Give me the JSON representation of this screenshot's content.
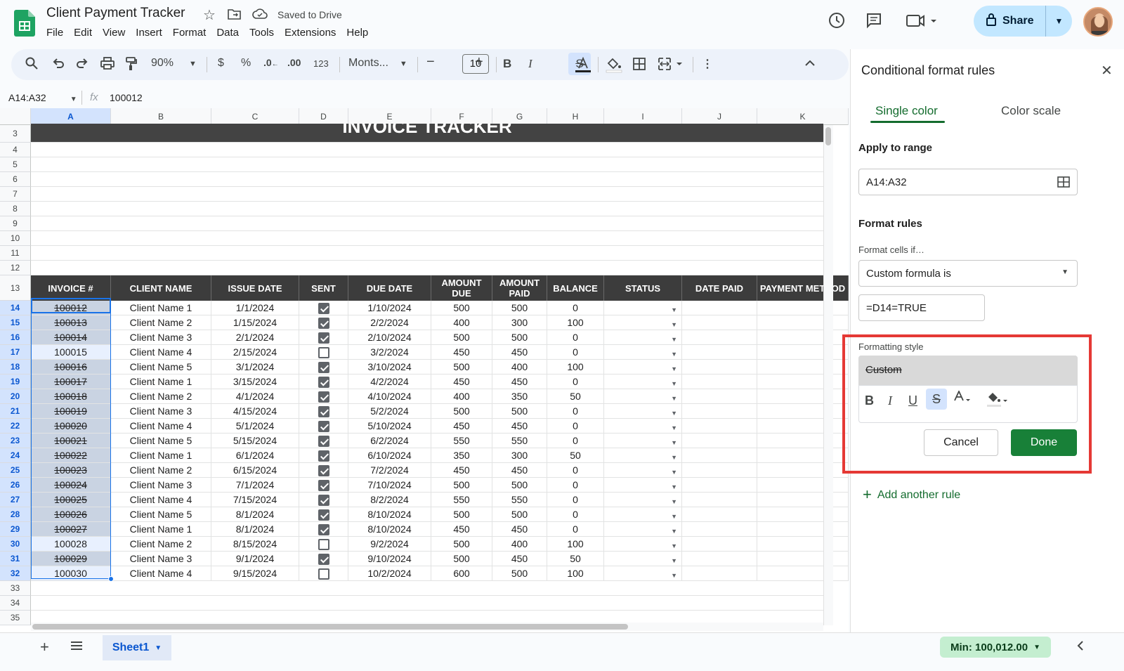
{
  "header": {
    "doc_title": "Client Payment Tracker",
    "saved_status": "Saved to Drive",
    "menus": [
      "File",
      "Edit",
      "View",
      "Insert",
      "Format",
      "Data",
      "Tools",
      "Extensions",
      "Help"
    ],
    "share_label": "Share"
  },
  "toolbar": {
    "zoom": "90%",
    "currency": "$",
    "percent": "%",
    "dec_less": ".0",
    "dec_more": ".00",
    "number_format": "123",
    "font": "Monts...",
    "font_size": "10"
  },
  "formula_bar": {
    "name_box": "A14:A32",
    "fx": "fx",
    "value": "100012"
  },
  "grid": {
    "columns": [
      "A",
      "B",
      "C",
      "D",
      "E",
      "F",
      "G",
      "H",
      "I",
      "J",
      "K"
    ],
    "row_numbers": [
      "3",
      "4",
      "5",
      "6",
      "7",
      "8",
      "9",
      "10",
      "11",
      "12",
      "13",
      "14",
      "15",
      "16",
      "17",
      "18",
      "19",
      "20",
      "21",
      "22",
      "23",
      "24",
      "25",
      "26",
      "27",
      "28",
      "29",
      "30",
      "31",
      "32",
      "33",
      "34",
      "35"
    ],
    "title_banner": "INVOICE TRACKER",
    "headers": [
      "INVOICE #",
      "CLIENT NAME",
      "ISSUE DATE",
      "SENT",
      "DUE DATE",
      "AMOUNT DUE",
      "AMOUNT PAID",
      "BALANCE",
      "STATUS",
      "DATE PAID",
      "PAYMENT METHOD"
    ],
    "rows": [
      [
        "100012",
        "Client Name 1",
        "1/1/2024",
        true,
        "1/10/2024",
        "500",
        "500",
        "0"
      ],
      [
        "100013",
        "Client Name 2",
        "1/15/2024",
        true,
        "2/2/2024",
        "400",
        "300",
        "100"
      ],
      [
        "100014",
        "Client Name 3",
        "2/1/2024",
        true,
        "2/10/2024",
        "500",
        "500",
        "0"
      ],
      [
        "100015",
        "Client Name 4",
        "2/15/2024",
        false,
        "3/2/2024",
        "450",
        "450",
        "0"
      ],
      [
        "100016",
        "Client Name 5",
        "3/1/2024",
        true,
        "3/10/2024",
        "500",
        "400",
        "100"
      ],
      [
        "100017",
        "Client Name 1",
        "3/15/2024",
        true,
        "4/2/2024",
        "450",
        "450",
        "0"
      ],
      [
        "100018",
        "Client Name 2",
        "4/1/2024",
        true,
        "4/10/2024",
        "400",
        "350",
        "50"
      ],
      [
        "100019",
        "Client Name 3",
        "4/15/2024",
        true,
        "5/2/2024",
        "500",
        "500",
        "0"
      ],
      [
        "100020",
        "Client Name 4",
        "5/1/2024",
        true,
        "5/10/2024",
        "450",
        "450",
        "0"
      ],
      [
        "100021",
        "Client Name 5",
        "5/15/2024",
        true,
        "6/2/2024",
        "550",
        "550",
        "0"
      ],
      [
        "100022",
        "Client Name 1",
        "6/1/2024",
        true,
        "6/10/2024",
        "350",
        "300",
        "50"
      ],
      [
        "100023",
        "Client Name 2",
        "6/15/2024",
        true,
        "7/2/2024",
        "450",
        "450",
        "0"
      ],
      [
        "100024",
        "Client Name 3",
        "7/1/2024",
        true,
        "7/10/2024",
        "500",
        "500",
        "0"
      ],
      [
        "100025",
        "Client Name 4",
        "7/15/2024",
        true,
        "8/2/2024",
        "550",
        "550",
        "0"
      ],
      [
        "100026",
        "Client Name 5",
        "8/1/2024",
        true,
        "8/10/2024",
        "500",
        "500",
        "0"
      ],
      [
        "100027",
        "Client Name 1",
        "8/1/2024",
        true,
        "8/10/2024",
        "450",
        "450",
        "0"
      ],
      [
        "100028",
        "Client Name 2",
        "8/15/2024",
        false,
        "9/2/2024",
        "500",
        "400",
        "100"
      ],
      [
        "100029",
        "Client Name 3",
        "9/1/2024",
        true,
        "9/10/2024",
        "500",
        "450",
        "50"
      ],
      [
        "100030",
        "Client Name 4",
        "9/15/2024",
        false,
        "10/2/2024",
        "600",
        "500",
        "100"
      ]
    ]
  },
  "sidebar": {
    "title": "Conditional format rules",
    "tabs": [
      "Single color",
      "Color scale"
    ],
    "apply_label": "Apply to range",
    "range": "A14:A32",
    "format_rules_label": "Format rules",
    "format_if_label": "Format cells if…",
    "condition": "Custom formula is",
    "formula": "=D14=TRUE",
    "style_label": "Formatting style",
    "style_preview": "Custom",
    "cancel_label": "Cancel",
    "done_label": "Done",
    "add_rule_label": "Add another rule"
  },
  "bottom": {
    "sheet_name": "Sheet1",
    "stat": "Min: 100,012.00"
  },
  "colors": {
    "accent_green": "#188038",
    "highlight_red": "#e53935",
    "header_dark": "#3c3c3c"
  }
}
